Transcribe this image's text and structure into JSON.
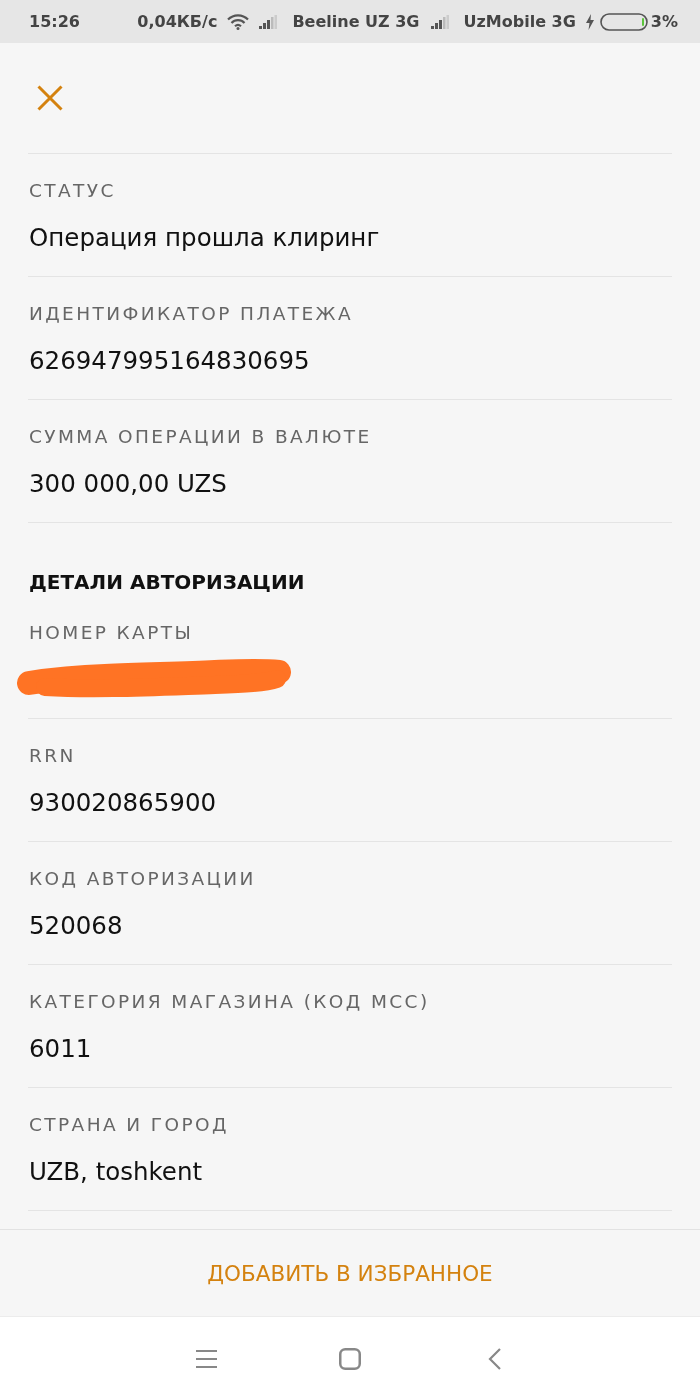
{
  "status_bar": {
    "time": "15:26",
    "net_speed": "0,04КБ/с",
    "carriers": [
      {
        "name": "Beeline UZ 3G"
      },
      {
        "name": "UzMobile 3G"
      }
    ],
    "battery_percent": "3%"
  },
  "sections": [
    {
      "fields": [
        {
          "kind": "text",
          "label": "СТАТУС",
          "value": "Операция прошла клиринг"
        },
        {
          "kind": "text",
          "label": "ИДЕНТИФИКАТОР ПЛАТЕЖА",
          "value": "626947995164830695"
        },
        {
          "kind": "text",
          "label": "СУММА ОПЕРАЦИИ В ВАЛЮТЕ",
          "value": "300 000,00 UZS"
        }
      ]
    },
    {
      "heading": "ДЕТАЛИ АВТОРИЗАЦИИ",
      "fields": [
        {
          "kind": "redacted",
          "label": "НОМЕР КАРТЫ"
        },
        {
          "kind": "text",
          "label": "RRN",
          "value": "930020865900"
        },
        {
          "kind": "text",
          "label": "КОД АВТОРИЗАЦИИ",
          "value": "520068"
        },
        {
          "kind": "text",
          "label": "КАТЕГОРИЯ МАГАЗИНА (КОД MCC)",
          "value": "6011"
        },
        {
          "kind": "text",
          "label": "СТРАНА И ГОРОД",
          "value": "UZB, toshkent"
        }
      ]
    }
  ],
  "favorite_button": {
    "label": "ДОБАВИТЬ В ИЗБРАННОЕ"
  }
}
